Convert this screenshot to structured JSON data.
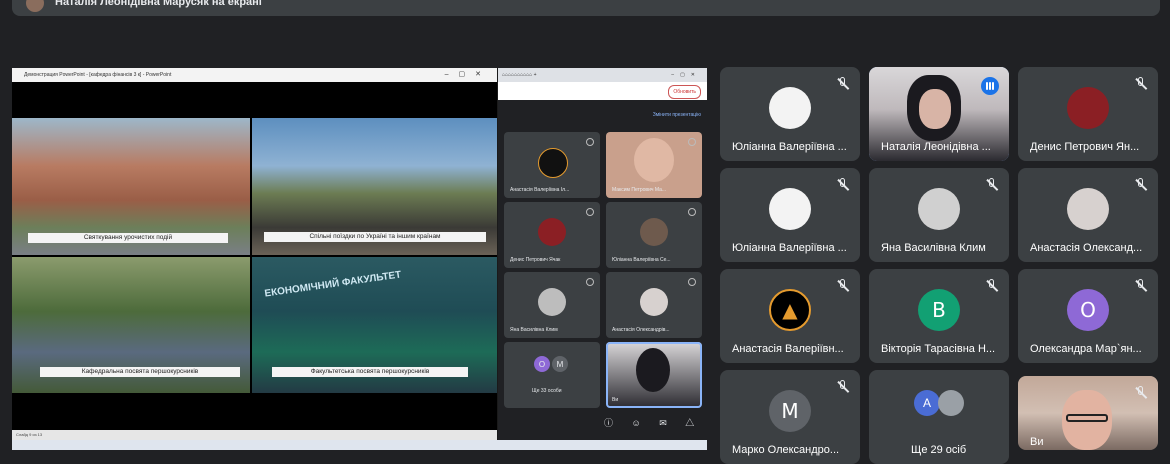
{
  "banner": {
    "text": "Наталія Леонідівна Марусяк на екрані"
  },
  "colors": {
    "bg": "#202124",
    "tile": "#3c4043",
    "active": "#8ab4f8",
    "speaking": "#1a73e8",
    "avatarB": "#12a073",
    "avatarO": "#8e69d6"
  },
  "shared": {
    "ppt_title": "Демонстрация PowerPoint - [кафедра фінансів 3 к] - PowerPoint",
    "captions": [
      "Святкування урочистих подій",
      "Спільні поїздки по Україні та іншим країнам",
      "Кафедральна посвята першокурсників",
      "Факультетська посвята першокурсників"
    ],
    "faculty_logo": "ЕКОНОМІЧНИЙ ФАКУЛЬТЕТ",
    "status": "Слайд 9 из 13",
    "refresh": "Обновить",
    "change_presentation": "Змінити презентацію",
    "mini_tiles": [
      {
        "name": "Анастасія Валеріївна Іл..."
      },
      {
        "name": "Максим Петрович Ма..."
      },
      {
        "name": "Денис Петрович Ячак"
      },
      {
        "name": "Юліанна Валеріївна Се..."
      },
      {
        "name": "Яна Василівна Клим"
      },
      {
        "name": "Анастасія Олександрів..."
      },
      {
        "name": "Ще 33 особи"
      },
      {
        "name": "Ви"
      }
    ],
    "mini_avatars": [
      "О",
      "М"
    ]
  },
  "grid": [
    {
      "name": "Юліанна Валеріївна ...",
      "type": "photo",
      "muted": true
    },
    {
      "name": "Наталія Леонідівна ...",
      "type": "video",
      "muted": false
    },
    {
      "name": "Денис Петрович Ян...",
      "type": "photo",
      "muted": true
    },
    {
      "name": "Юліанна Валеріївна ...",
      "type": "photo",
      "muted": true
    },
    {
      "name": "Яна Василівна Клим",
      "type": "photo",
      "muted": true
    },
    {
      "name": "Анастасія Олександ...",
      "type": "photo",
      "muted": true
    },
    {
      "name": "Анастасія Валеріївн...",
      "type": "photo",
      "muted": true
    },
    {
      "name": "Вікторія Тарасівна Н...",
      "type": "letter",
      "letter": "В",
      "muted": true
    },
    {
      "name": "Олександра Мар`ян...",
      "type": "letter",
      "letter": "О",
      "muted": true
    },
    {
      "name": "Марко Олександро...",
      "type": "letter",
      "letter": "М",
      "muted": true
    },
    {
      "name": "Ще 29 осіб",
      "type": "more",
      "letter": "А",
      "muted": false
    },
    {
      "name": "Ви",
      "type": "video2",
      "muted": true
    }
  ]
}
